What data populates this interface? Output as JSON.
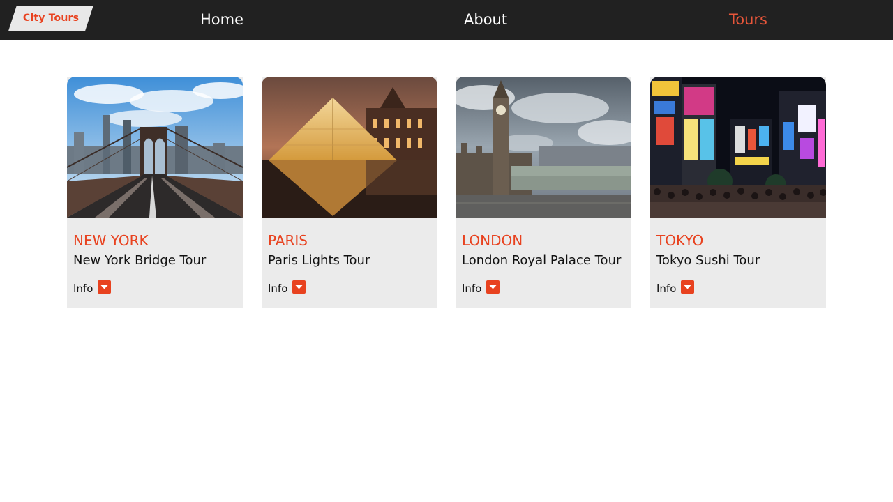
{
  "brand": {
    "logo_text": "City Tours"
  },
  "nav": {
    "items": [
      {
        "label": "Home",
        "active": false
      },
      {
        "label": "About",
        "active": false
      },
      {
        "label": "Tours",
        "active": true
      }
    ]
  },
  "colors": {
    "nav_background": "#212121",
    "accent": "#e8421f",
    "card_background": "#ebebeb"
  },
  "tours": [
    {
      "city": "NEW YORK",
      "name": "New York Bridge Tour",
      "info_label": "Info",
      "photo": "brooklyn-bridge-photo"
    },
    {
      "city": "PARIS",
      "name": "Paris Lights Tour",
      "info_label": "Info",
      "photo": "louvre-pyramid-photo"
    },
    {
      "city": "LONDON",
      "name": "London Royal Palace Tour",
      "info_label": "Info",
      "photo": "big-ben-bridge-photo"
    },
    {
      "city": "TOKYO",
      "name": "Tokyo Sushi Tour",
      "info_label": "Info",
      "photo": "shibuya-night-photo"
    }
  ],
  "icons": {
    "info_toggle": "caret-down-icon"
  }
}
